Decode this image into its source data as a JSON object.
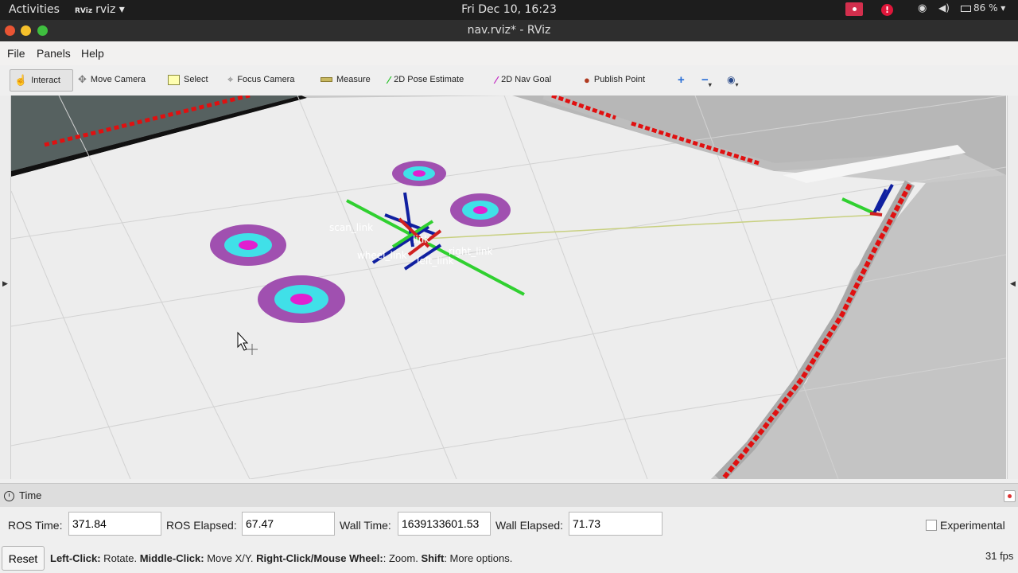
{
  "topbar": {
    "activities": "Activities",
    "app_menu": "rviz ▾",
    "app_glyph": "RViz",
    "clock": "Fri Dec 10, 16:23",
    "battery": "86 % ▾"
  },
  "window": {
    "title": "nav.rviz* - RViz"
  },
  "menu": {
    "items": [
      "File",
      "Panels",
      "Help"
    ]
  },
  "toolbar": {
    "tools": [
      {
        "label": "Interact",
        "icon": "hand-icon",
        "active": true
      },
      {
        "label": "Move Camera",
        "icon": "move-camera-icon"
      },
      {
        "label": "Select",
        "icon": "select-icon"
      },
      {
        "label": "Focus Camera",
        "icon": "focus-camera-icon"
      },
      {
        "label": "Measure",
        "icon": "measure-icon"
      },
      {
        "label": "2D Pose Estimate",
        "icon": "pose-estimate-icon"
      },
      {
        "label": "2D Nav Goal",
        "icon": "nav-goal-icon"
      },
      {
        "label": "Publish Point",
        "icon": "publish-point-icon"
      }
    ]
  },
  "view": {
    "frame_labels": [
      "right_link",
      "link",
      "wheel_link",
      "left_link",
      "scan_link"
    ]
  },
  "time_panel": {
    "title": "Time",
    "ros_time_label": "ROS Time:",
    "ros_time_value": "371.84",
    "ros_elapsed_label": "ROS Elapsed:",
    "ros_elapsed_value": "67.47",
    "wall_time_label": "Wall Time:",
    "wall_time_value": "1639133601.53",
    "wall_elapsed_label": "Wall Elapsed:",
    "wall_elapsed_value": "71.73",
    "experimental_label": "Experimental"
  },
  "status": {
    "reset_label": "Reset",
    "hint_left_click_key": "Left-Click:",
    "hint_left_click_text": " Rotate. ",
    "hint_middle_click_key": "Middle-Click:",
    "hint_middle_click_text": " Move X/Y. ",
    "hint_right_click_key": "Right-Click/Mouse Wheel:",
    "hint_right_click_text": ": Zoom. ",
    "hint_shift_key": "Shift",
    "hint_shift_text": ": More options.",
    "fps": "31 fps"
  },
  "colors": {
    "laser_scan": "#e01010",
    "costmap_outer": "#a050b0",
    "costmap_inner": "#40e0e8",
    "costmap_core": "#e020d0",
    "axis_x": "#d02020",
    "axis_y": "#30d030",
    "axis_z": "#1020a0"
  }
}
